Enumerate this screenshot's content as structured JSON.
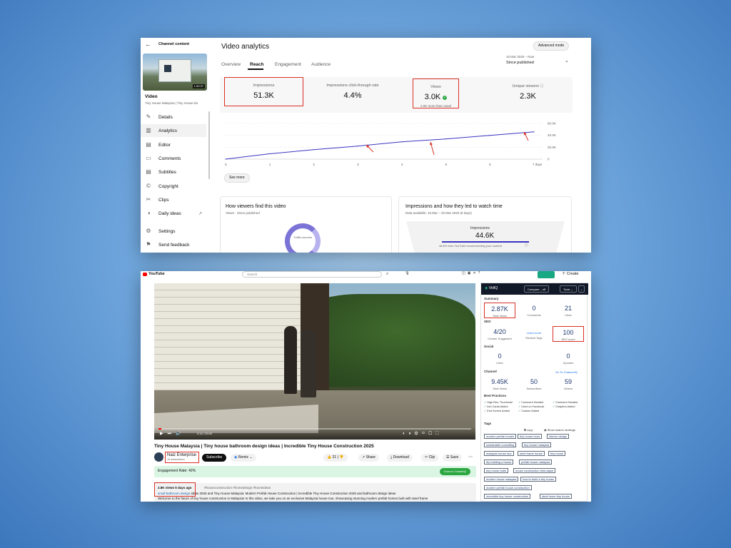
{
  "studio": {
    "back_label": "Channel content",
    "thumb_time": "1:00:37",
    "video_label": "Video",
    "video_sub": "Tiny House Malaysia | Tiny House ba",
    "sidebar": [
      {
        "label": "Details",
        "icon": "pencil-icon"
      },
      {
        "label": "Analytics",
        "icon": "bar-chart-icon"
      },
      {
        "label": "Editor",
        "icon": "film-icon"
      },
      {
        "label": "Comments",
        "icon": "comment-icon"
      },
      {
        "label": "Subtitles",
        "icon": "subtitles-icon"
      },
      {
        "label": "Copyright",
        "icon": "copyright-icon"
      },
      {
        "label": "Clips",
        "icon": "scissors-icon"
      },
      {
        "label": "Daily ideas",
        "icon": "lightbulb-icon",
        "external": true
      },
      {
        "label": "Settings",
        "icon": "gear-icon"
      },
      {
        "label": "Send feedback",
        "icon": "feedback-icon"
      }
    ],
    "title": "Video analytics",
    "advanced_btn": "Advanced mode",
    "tabs": [
      "Overview",
      "Reach",
      "Engagement",
      "Audience"
    ],
    "active_tab": "Reach",
    "date_range": "15 Mar 2025 – Now",
    "date_sub": "Since published",
    "metrics": [
      {
        "label": "Impressions",
        "value": "51.3K",
        "sub": ""
      },
      {
        "label": "Impressions click-through rate",
        "value": "4.4%",
        "sub": ""
      },
      {
        "label": "Views",
        "value": "3.0K",
        "sub": "2.6K more than usual"
      },
      {
        "label": "Unique viewers",
        "value": "2.3K",
        "sub": ""
      }
    ],
    "chart_data": {
      "type": "line",
      "x": [
        0,
        1,
        2,
        3,
        4,
        5,
        6,
        7
      ],
      "x_ticks": [
        "0",
        "1",
        "2",
        "3",
        "4",
        "5",
        "6",
        "7 days"
      ],
      "y_ticks": [
        "0",
        "20.0K",
        "40.0K",
        "60.0K"
      ],
      "ylim": [
        0,
        60000
      ],
      "values": [
        0,
        9000,
        16000,
        22000,
        29000,
        34000,
        40000,
        46000
      ]
    },
    "see_more": "See more",
    "card1_title": "How viewers find this video",
    "card1_sub": "Views · Since published",
    "donut_label": "Traffic sources",
    "card2_title": "Impressions and how they led to watch time",
    "card2_sub": "Data available: 15 Mar – 20 Mar 2025 (6 days)",
    "funnel_label": "Impressions",
    "funnel_value": "44.6K",
    "funnel_note": "48.8% from YouTube recommending your content"
  },
  "yt": {
    "logo": "YouTube",
    "search_placeholder": "Search",
    "create_btn": "Create",
    "video_time": "0:14 / 25:00",
    "video_title": "Tiny House Malaysia | Tiny house bathroom design ideas | Incredible Tiny House Construction 2025",
    "channel_name": "Naiz Enterprise",
    "subscribers": "19 subscribers",
    "subscribe": "Subscribe",
    "remix": "Remix",
    "likes": "21",
    "share": "Share",
    "download": "Download",
    "clip": "Clip",
    "save": "Save",
    "engagement": "Engagement Rate: 42%",
    "engagement_btn": "Grow to CreateIQ",
    "desc_stats": "2.8K views  5 days ago",
    "desc_tags": "#houseconstruction #homedesign #homeideas",
    "desc_line1a": "small bathroom design",
    "desc_line1b": " ideas 2025 and Tiny House Malaysia: Modern Prefab House Construction | Incredible Tiny House Construction 2025 and bathroom design ideas",
    "desc_line2": "Welcome to the future of tiny house construction in Malaysia! In this video, we take you on an exclusive Malaysia house tour, showcasing stunning modern prefab homes built with steel frame",
    "vidiq": {
      "brand": "VidIQ",
      "compare_btn": "Compare – off",
      "tools_btn": "Tools",
      "summary_label": "Summary",
      "summary": [
        {
          "value": "2.87K",
          "label": "Total Views"
        },
        {
          "value": "0",
          "label": "Comments"
        },
        {
          "value": "21",
          "label": "Likes"
        }
      ],
      "seo_label": "SEO",
      "seo": [
        {
          "value": "4/20",
          "label": "Creator Suggested"
        },
        {
          "value": "Learn more",
          "label": "Ranked Tags"
        },
        {
          "value": "100",
          "label": "SEO score"
        }
      ],
      "social_label": "Social",
      "social": [
        {
          "value": "0",
          "label": "Likes"
        },
        {
          "value": "0",
          "label": "Upvotes"
        }
      ],
      "channel_label": "Channel",
      "channel_link": "Go To Channel!Q",
      "channel": [
        {
          "value": "9.45K",
          "label": "Total Views"
        },
        {
          "value": "50",
          "label": "Subscribers"
        },
        {
          "value": "59",
          "label": "Videos"
        }
      ],
      "best_label": "Best Practices",
      "best": [
        "High Res. Thumbnail",
        "Comment Hearted",
        "Comment Hearted",
        "Info Cards Added",
        "Liked on Facebook",
        "Chapters Added",
        "End Screen Added",
        "Custom Added"
      ],
      "tags_label": "Tags",
      "copy": "copy",
      "show_rankings": "Show search rankings",
      "tags": [
        [
          "modern prefab homes",
          "tiny house tours",
          "interior design"
        ],
        [
          "sustainable consulting",
          "tiny house malaysia"
        ],
        [
          "malaysia house tour",
          "steel frame house",
          "tiny house"
        ],
        [
          "diy building a house",
          "prefab house malaysia"
        ],
        [
          "tiny house build",
          "house construction time-lapse"
        ],
        [
          "modern house malaysia",
          "how to build a tiny house"
        ],
        [
          "modern prefab house construction"
        ],
        [
          "incredible tiny house construction",
          "ideal home tiny house"
        ]
      ]
    }
  }
}
